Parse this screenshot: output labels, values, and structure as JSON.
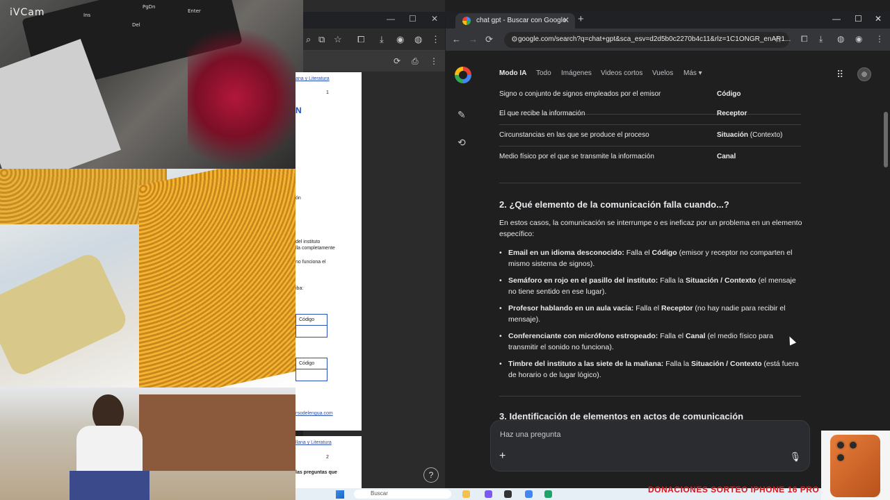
{
  "webcam": {
    "label": "iVCam"
  },
  "keyboard_keys": [
    "Ins",
    "PgDn",
    "Enter",
    "Del",
    "PgDn"
  ],
  "left_doc": {
    "header": "ana y Literatura",
    "page_num": "1",
    "heading_frag": "N",
    "lines": [
      "ón",
      "del instituto",
      "lla completamente",
      "no funciona el",
      "iba:"
    ],
    "box1_label": "Código",
    "box2_label": "Código",
    "link": "rsodelengua.com",
    "header2": "llana y Literatura",
    "page_num2": "2",
    "footer_text": "las preguntas que"
  },
  "browser": {
    "tab_title": "chat gpt - Buscar con Google",
    "url": "google.com/search?q=chat+gpt&sca_esv=d2d5b0c2270b4c11&rlz=1C1ONGR_enAR1..."
  },
  "search_tabs": [
    "Modo IA",
    "Todo",
    "Imágenes",
    "Videos cortos",
    "Vuelos",
    "Más"
  ],
  "table_rows": [
    {
      "desc": "Signo o conjunto de signos empleados por el emisor",
      "value": "Código",
      "extra": ""
    },
    {
      "desc": "El que recibe la información",
      "value": "Receptor",
      "extra": ""
    },
    {
      "desc": "Circunstancias en las que se produce el proceso",
      "value": "Situación",
      "extra": " (Contexto)"
    },
    {
      "desc": "Medio físico por el que se transmite la información",
      "value": "Canal",
      "extra": ""
    }
  ],
  "section2": {
    "heading": "2. ¿Qué elemento de la comunicación falla cuando...?",
    "intro": "En estos casos, la comunicación se interrumpe o es ineficaz por un problema en un elemento específico:",
    "bullets": [
      {
        "bold": "Email en un idioma desconocido:",
        "pre": " Falla el ",
        "elem": "Código",
        "rest": " (emisor y receptor no comparten el mismo sistema de signos)."
      },
      {
        "bold": "Semáforo en rojo en el pasillo del instituto:",
        "pre": " Falla la ",
        "elem": "Situación / Contexto",
        "rest": " (el mensaje no tiene sentido en ese lugar)."
      },
      {
        "bold": "Profesor hablando en un aula vacía:",
        "pre": " Falla el ",
        "elem": "Receptor",
        "rest": " (no hay nadie para recibir el mensaje)."
      },
      {
        "bold": "Conferenciante con micrófono estropeado:",
        "pre": " Falla el ",
        "elem": "Canal",
        "rest": " (el medio físico para transmitir el sonido no funciona)."
      },
      {
        "bold": "Timbre del instituto a las siete de la mañana:",
        "pre": " Falla la ",
        "elem": "Situación / Contexto",
        "rest": " (está fuera de horario o de lugar lógico)."
      }
    ]
  },
  "section3": {
    "heading": "3. Identificación de elementos en actos de comunicación"
  },
  "ask": {
    "placeholder": "Haz una pregunta"
  },
  "taskbar": {
    "search_label": "Buscar"
  },
  "promo": {
    "text": "DONACIONES SORTEO IPHONE 16 PRO"
  },
  "colors": {
    "bg": "#1f1f1f",
    "text": "#e8eaed",
    "divider": "#3c4043",
    "promo_red": "#d8161c"
  }
}
